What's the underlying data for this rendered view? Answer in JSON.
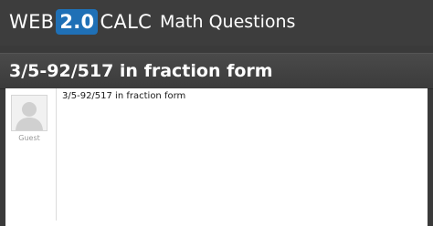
{
  "header": {
    "logo_left": "WEB",
    "logo_badge": "2.0",
    "logo_right": "CALC",
    "section": "Math Questions"
  },
  "question": {
    "title": "3/5-92/517 in fraction form",
    "body": "3/5-92/517 in fraction form",
    "author": "Guest"
  }
}
